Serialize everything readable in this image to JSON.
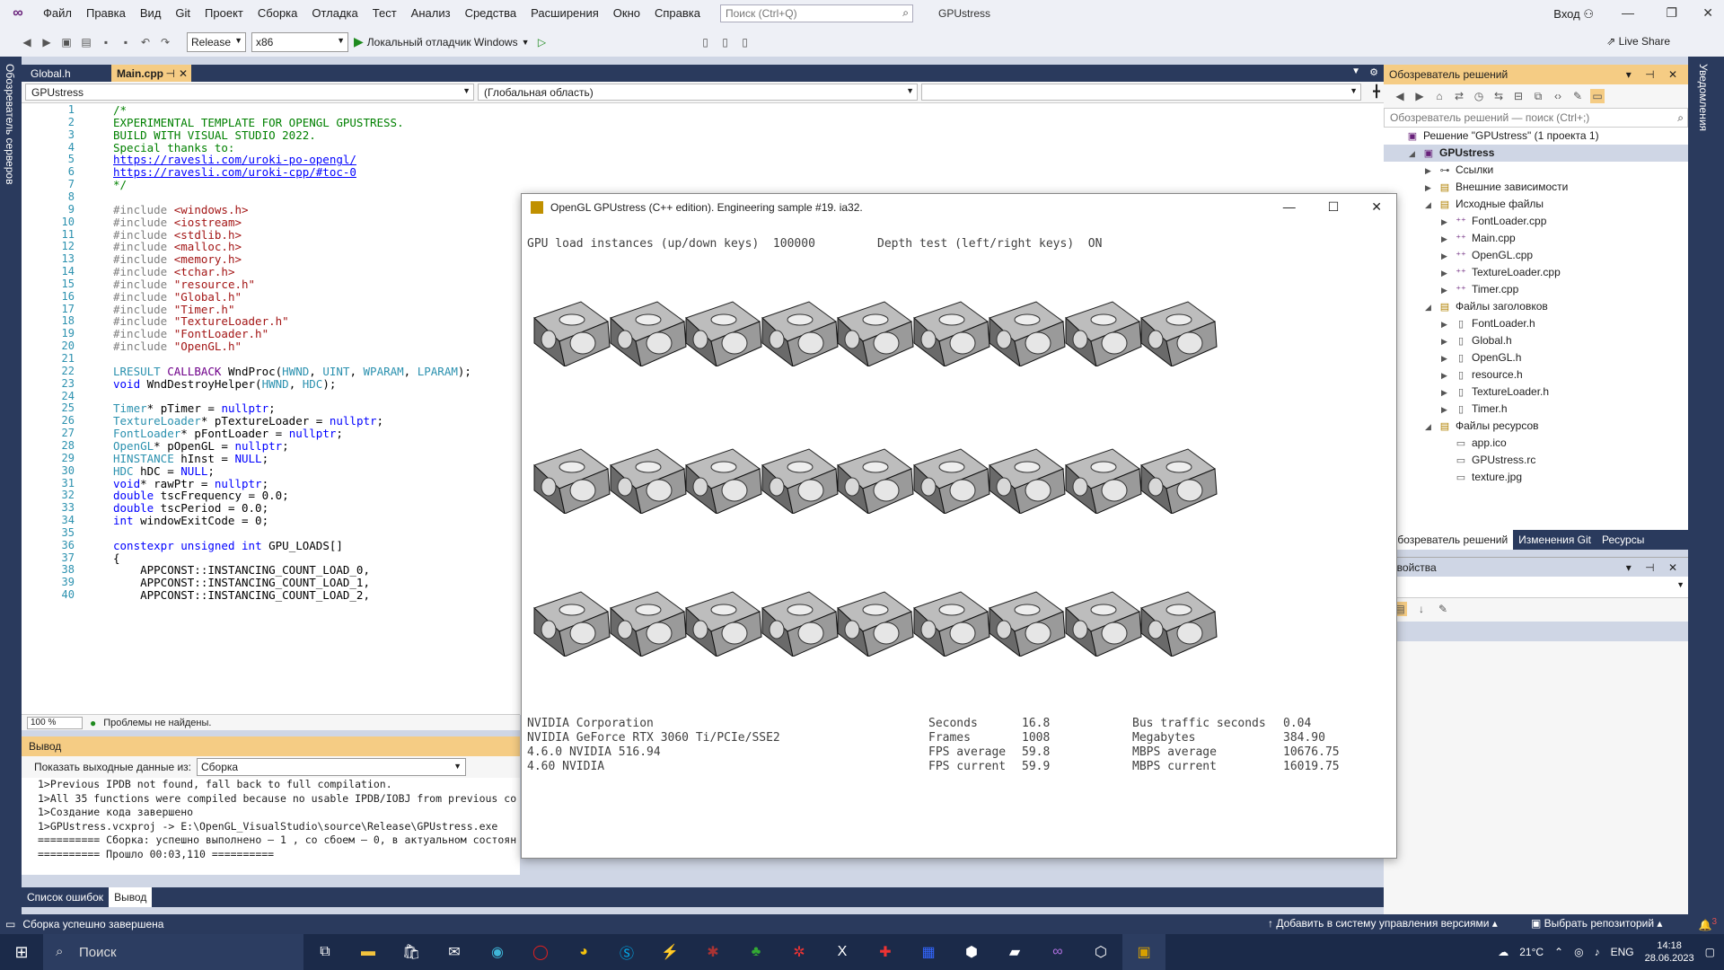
{
  "menu": [
    "Файл",
    "Правка",
    "Вид",
    "Git",
    "Проект",
    "Сборка",
    "Отладка",
    "Тест",
    "Анализ",
    "Средства",
    "Расширения",
    "Окно",
    "Справка"
  ],
  "search_placeholder": "Поиск (Ctrl+Q)",
  "solution_title": "GPUstress",
  "login": "Вход",
  "toolbar": {
    "config": "Release",
    "platform": "x86",
    "run_label": "Локальный отладчик Windows",
    "live_share": "Live Share"
  },
  "left_strip": "Обозреватель серверов",
  "right_strip": "Уведомления",
  "editor": {
    "tabs": [
      "Global.h",
      "Main.cpp"
    ],
    "nav_project": "GPUstress",
    "nav_scope": "(Глобальная область)",
    "zoom": "100 %",
    "status": "Проблемы не найдены."
  },
  "line_numbers": [
    "1",
    "2",
    "3",
    "4",
    "5",
    "6",
    "7",
    "8",
    "9",
    "10",
    "11",
    "12",
    "13",
    "14",
    "15",
    "16",
    "17",
    "18",
    "19",
    "20",
    "21",
    "22",
    "23",
    "24",
    "25",
    "26",
    "27",
    "28",
    "29",
    "30",
    "31",
    "32",
    "33",
    "34",
    "35",
    "36",
    "37",
    "38",
    "39",
    "40"
  ],
  "code": [
    "/*",
    "EXPERIMENTAL TEMPLATE FOR OPENGL GPUSTRESS.",
    "BUILD WITH VISUAL STUDIO 2022.",
    "Special thanks to:",
    "https://ravesli.com/uroki-po-opengl/",
    "https://ravesli.com/uroki-cpp/#toc-0",
    "*/",
    "",
    "#include <windows.h>",
    "#include <iostream>",
    "#include <stdlib.h>",
    "#include <malloc.h>",
    "#include <memory.h>",
    "#include <tchar.h>",
    "#include \"resource.h\"",
    "#include \"Global.h\"",
    "#include \"Timer.h\"",
    "#include \"TextureLoader.h\"",
    "#include \"FontLoader.h\"",
    "#include \"OpenGL.h\"",
    "",
    "LRESULT CALLBACK WndProc(HWND, UINT, WPARAM, LPARAM);",
    "void WndDestroyHelper(HWND, HDC);",
    "",
    "Timer* pTimer = nullptr;",
    "TextureLoader* pTextureLoader = nullptr;",
    "FontLoader* pFontLoader = nullptr;",
    "OpenGL* pOpenGL = nullptr;",
    "HINSTANCE hInst = NULL;",
    "HDC hDC = NULL;",
    "void* rawPtr = nullptr;",
    "double tscFrequency = 0.0;",
    "double tscPeriod = 0.0;",
    "int windowExitCode = 0;",
    "",
    "constexpr unsigned int GPU_LOADS[]",
    "{",
    "    APPCONST::INSTANCING_COUNT_LOAD_0,",
    "    APPCONST::INSTANCING_COUNT_LOAD_1,",
    "    APPCONST::INSTANCING_COUNT_LOAD_2,"
  ],
  "output": {
    "title": "Вывод",
    "show_from_label": "Показать выходные данные из:",
    "source": "Сборка",
    "lines": [
      "1>Previous IPDB not found, fall back to full compilation.",
      "1>All 35 functions were compiled because no usable IPDB/IOBJ from previous co",
      "1>Создание кода завершено",
      "1>GPUstress.vcxproj -> E:\\OpenGL_VisualStudio\\source\\Release\\GPUstress.exe",
      "========== Сборка: успешно выполнено — 1 , со сбоем — 0, в актуальном состоян",
      "========== Прошло 00:03,110 =========="
    ]
  },
  "bottom_tabs": [
    "Список ошибок",
    "Вывод"
  ],
  "solution_explorer": {
    "title": "Обозреватель решений",
    "search_placeholder": "Обозреватель решений — поиск (Ctrl+;)",
    "tree": [
      {
        "label": "Решение \"GPUstress\" (1 проекта 1)",
        "depth": 0
      },
      {
        "label": "GPUstress",
        "depth": 1,
        "bold": true
      },
      {
        "label": "Ссылки",
        "depth": 2
      },
      {
        "label": "Внешние зависимости",
        "depth": 2
      },
      {
        "label": "Исходные файлы",
        "depth": 2
      },
      {
        "label": "FontLoader.cpp",
        "depth": 3
      },
      {
        "label": "Main.cpp",
        "depth": 3
      },
      {
        "label": "OpenGL.cpp",
        "depth": 3
      },
      {
        "label": "TextureLoader.cpp",
        "depth": 3
      },
      {
        "label": "Timer.cpp",
        "depth": 3
      },
      {
        "label": "Файлы заголовков",
        "depth": 2
      },
      {
        "label": "FontLoader.h",
        "depth": 3
      },
      {
        "label": "Global.h",
        "depth": 3
      },
      {
        "label": "OpenGL.h",
        "depth": 3
      },
      {
        "label": "resource.h",
        "depth": 3
      },
      {
        "label": "TextureLoader.h",
        "depth": 3
      },
      {
        "label": "Timer.h",
        "depth": 3
      },
      {
        "label": "Файлы ресурсов",
        "depth": 2
      },
      {
        "label": "app.ico",
        "depth": 3
      },
      {
        "label": "GPUstress.rc",
        "depth": 3
      },
      {
        "label": "texture.jpg",
        "depth": 3
      }
    ],
    "tabs": [
      "Обозреватель решений",
      "Изменения Git",
      "Ресурсы"
    ]
  },
  "properties_title": "Свойства",
  "status": {
    "left": "Сборка успешно завершена",
    "vcs": "Добавить в систему управления версиями",
    "repo": "Выбрать репозиторий",
    "notifications": "3"
  },
  "taskbar": {
    "search": "Поиск",
    "temp": "21°C",
    "lang": "ENG",
    "time": "14:18",
    "date": "28.06.2023"
  },
  "gl": {
    "title": "OpenGL GPUstress (C++ edition). Engineering sample #19. ia32.",
    "load_label": "GPU load instances (up/down keys)  100000",
    "depth_label": "Depth test (left/right keys)  ON",
    "info_left": [
      "NVIDIA Corporation",
      "NVIDIA GeForce RTX 3060 Ti/PCIe/SSE2",
      "4.6.0 NVIDIA 516.94",
      "4.60 NVIDIA"
    ],
    "stats_mid_labels": [
      "Seconds",
      "Frames",
      "FPS average",
      "FPS current"
    ],
    "stats_mid_values": [
      "16.8",
      "1008",
      "59.8",
      "59.9"
    ],
    "stats_right_labels": [
      "Bus traffic seconds",
      "Megabytes",
      "MBPS average",
      "MBPS current"
    ],
    "stats_right_values": [
      "0.04",
      "384.90",
      "10676.75",
      "16019.75"
    ]
  }
}
